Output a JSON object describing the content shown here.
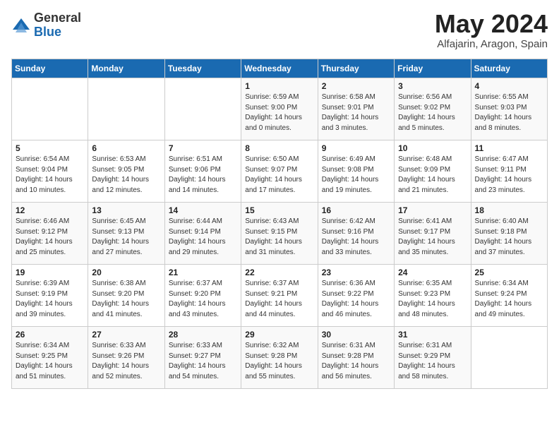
{
  "logo": {
    "general": "General",
    "blue": "Blue"
  },
  "title": "May 2024",
  "location": "Alfajarin, Aragon, Spain",
  "days_of_week": [
    "Sunday",
    "Monday",
    "Tuesday",
    "Wednesday",
    "Thursday",
    "Friday",
    "Saturday"
  ],
  "weeks": [
    [
      {
        "day": "",
        "info": ""
      },
      {
        "day": "",
        "info": ""
      },
      {
        "day": "",
        "info": ""
      },
      {
        "day": "1",
        "info": "Sunrise: 6:59 AM\nSunset: 9:00 PM\nDaylight: 14 hours\nand 0 minutes."
      },
      {
        "day": "2",
        "info": "Sunrise: 6:58 AM\nSunset: 9:01 PM\nDaylight: 14 hours\nand 3 minutes."
      },
      {
        "day": "3",
        "info": "Sunrise: 6:56 AM\nSunset: 9:02 PM\nDaylight: 14 hours\nand 5 minutes."
      },
      {
        "day": "4",
        "info": "Sunrise: 6:55 AM\nSunset: 9:03 PM\nDaylight: 14 hours\nand 8 minutes."
      }
    ],
    [
      {
        "day": "5",
        "info": "Sunrise: 6:54 AM\nSunset: 9:04 PM\nDaylight: 14 hours\nand 10 minutes."
      },
      {
        "day": "6",
        "info": "Sunrise: 6:53 AM\nSunset: 9:05 PM\nDaylight: 14 hours\nand 12 minutes."
      },
      {
        "day": "7",
        "info": "Sunrise: 6:51 AM\nSunset: 9:06 PM\nDaylight: 14 hours\nand 14 minutes."
      },
      {
        "day": "8",
        "info": "Sunrise: 6:50 AM\nSunset: 9:07 PM\nDaylight: 14 hours\nand 17 minutes."
      },
      {
        "day": "9",
        "info": "Sunrise: 6:49 AM\nSunset: 9:08 PM\nDaylight: 14 hours\nand 19 minutes."
      },
      {
        "day": "10",
        "info": "Sunrise: 6:48 AM\nSunset: 9:09 PM\nDaylight: 14 hours\nand 21 minutes."
      },
      {
        "day": "11",
        "info": "Sunrise: 6:47 AM\nSunset: 9:11 PM\nDaylight: 14 hours\nand 23 minutes."
      }
    ],
    [
      {
        "day": "12",
        "info": "Sunrise: 6:46 AM\nSunset: 9:12 PM\nDaylight: 14 hours\nand 25 minutes."
      },
      {
        "day": "13",
        "info": "Sunrise: 6:45 AM\nSunset: 9:13 PM\nDaylight: 14 hours\nand 27 minutes."
      },
      {
        "day": "14",
        "info": "Sunrise: 6:44 AM\nSunset: 9:14 PM\nDaylight: 14 hours\nand 29 minutes."
      },
      {
        "day": "15",
        "info": "Sunrise: 6:43 AM\nSunset: 9:15 PM\nDaylight: 14 hours\nand 31 minutes."
      },
      {
        "day": "16",
        "info": "Sunrise: 6:42 AM\nSunset: 9:16 PM\nDaylight: 14 hours\nand 33 minutes."
      },
      {
        "day": "17",
        "info": "Sunrise: 6:41 AM\nSunset: 9:17 PM\nDaylight: 14 hours\nand 35 minutes."
      },
      {
        "day": "18",
        "info": "Sunrise: 6:40 AM\nSunset: 9:18 PM\nDaylight: 14 hours\nand 37 minutes."
      }
    ],
    [
      {
        "day": "19",
        "info": "Sunrise: 6:39 AM\nSunset: 9:19 PM\nDaylight: 14 hours\nand 39 minutes."
      },
      {
        "day": "20",
        "info": "Sunrise: 6:38 AM\nSunset: 9:20 PM\nDaylight: 14 hours\nand 41 minutes."
      },
      {
        "day": "21",
        "info": "Sunrise: 6:37 AM\nSunset: 9:20 PM\nDaylight: 14 hours\nand 43 minutes."
      },
      {
        "day": "22",
        "info": "Sunrise: 6:37 AM\nSunset: 9:21 PM\nDaylight: 14 hours\nand 44 minutes."
      },
      {
        "day": "23",
        "info": "Sunrise: 6:36 AM\nSunset: 9:22 PM\nDaylight: 14 hours\nand 46 minutes."
      },
      {
        "day": "24",
        "info": "Sunrise: 6:35 AM\nSunset: 9:23 PM\nDaylight: 14 hours\nand 48 minutes."
      },
      {
        "day": "25",
        "info": "Sunrise: 6:34 AM\nSunset: 9:24 PM\nDaylight: 14 hours\nand 49 minutes."
      }
    ],
    [
      {
        "day": "26",
        "info": "Sunrise: 6:34 AM\nSunset: 9:25 PM\nDaylight: 14 hours\nand 51 minutes."
      },
      {
        "day": "27",
        "info": "Sunrise: 6:33 AM\nSunset: 9:26 PM\nDaylight: 14 hours\nand 52 minutes."
      },
      {
        "day": "28",
        "info": "Sunrise: 6:33 AM\nSunset: 9:27 PM\nDaylight: 14 hours\nand 54 minutes."
      },
      {
        "day": "29",
        "info": "Sunrise: 6:32 AM\nSunset: 9:28 PM\nDaylight: 14 hours\nand 55 minutes."
      },
      {
        "day": "30",
        "info": "Sunrise: 6:31 AM\nSunset: 9:28 PM\nDaylight: 14 hours\nand 56 minutes."
      },
      {
        "day": "31",
        "info": "Sunrise: 6:31 AM\nSunset: 9:29 PM\nDaylight: 14 hours\nand 58 minutes."
      },
      {
        "day": "",
        "info": ""
      }
    ]
  ]
}
